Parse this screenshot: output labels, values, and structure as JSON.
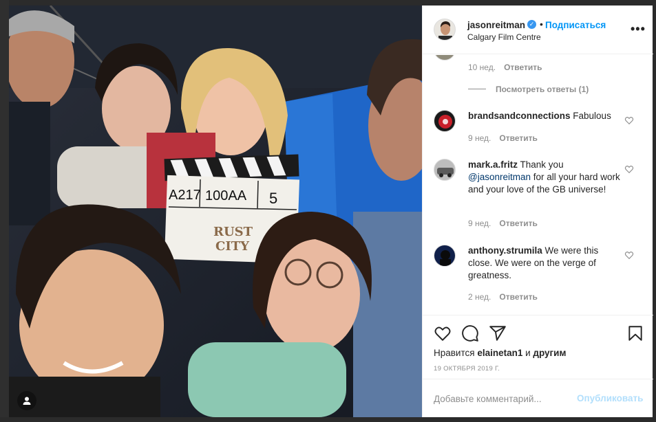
{
  "post": {
    "username": "jasonreitman",
    "follow_label": "Подписаться",
    "dot": "•",
    "location": "Calgary Film Centre",
    "more_label": "•••",
    "photo_slate": {
      "scene": "A217",
      "take_roll": "100AA",
      "take": "5",
      "title_top": "RUST",
      "title_bottom": "CITY"
    }
  },
  "comments": {
    "previous": {
      "time": "10 нед.",
      "reply_label": "Ответить"
    },
    "view_replies": "Посмотреть ответы (1)",
    "items": [
      {
        "author": "brandsandconnections",
        "text": " Fabulous",
        "mention": "",
        "text_after": "",
        "time": "9 нед.",
        "reply_label": "Ответить"
      },
      {
        "author": "mark.a.fritz",
        "text": " Thank you ",
        "mention": "@jasonreitman",
        "text_after": " for all your hard work and your love of the GB universe!",
        "time": "9 нед.",
        "reply_label": "Ответить"
      },
      {
        "author": "anthony.strumila",
        "text": " We were this close. We were on the verge of greatness.",
        "mention": "",
        "text_after": "",
        "time": "2 нед.",
        "reply_label": "Ответить"
      }
    ]
  },
  "actions": {
    "likes_prefix": "Нравится ",
    "likes_user": "elainetan1",
    "likes_mid": " и ",
    "likes_suffix": "другим",
    "date": "19 октября 2019 г."
  },
  "add_comment": {
    "placeholder": "Добавьте комментарий...",
    "publish_label": "Опубликовать"
  },
  "colors": {
    "accent": "#0095f6",
    "publish_disabled": "#b2dffc",
    "text": "#262626",
    "muted": "#8e8e8e"
  },
  "icons": [
    "heart-icon",
    "comment-icon",
    "share-icon",
    "bookmark-icon",
    "user-tag-icon",
    "verified-badge-icon",
    "more-options-icon"
  ]
}
